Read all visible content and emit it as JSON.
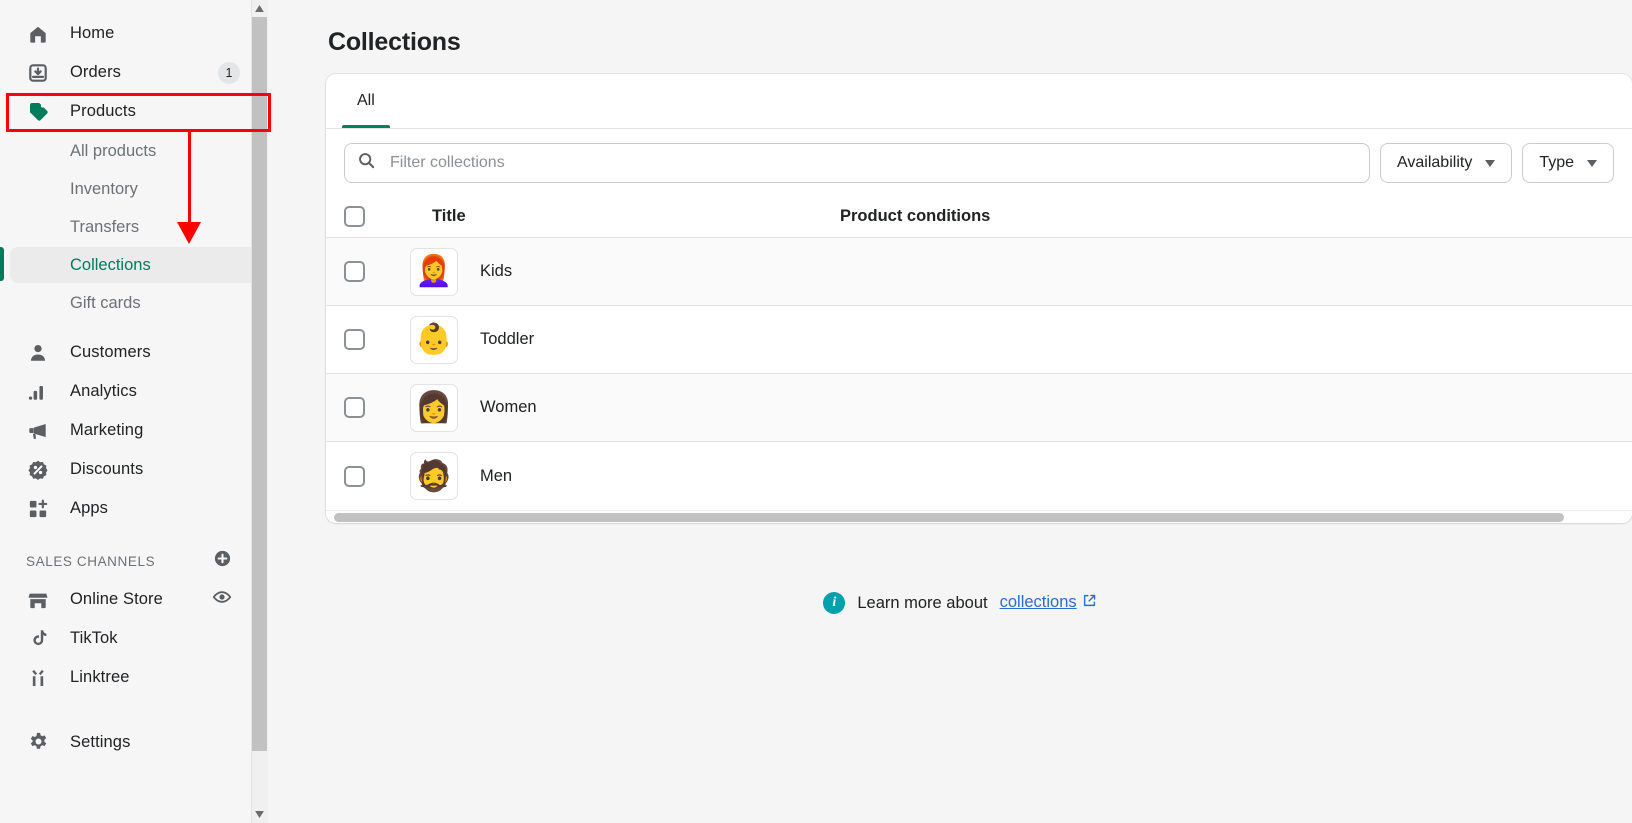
{
  "sidebar": {
    "nav": [
      {
        "label": "Home",
        "icon": "home-icon"
      },
      {
        "label": "Orders",
        "icon": "orders-inbox-icon",
        "badge": "1"
      },
      {
        "label": "Products",
        "icon": "products-tag-icon",
        "highlighted": true
      }
    ],
    "product_subnav": [
      {
        "label": "All products"
      },
      {
        "label": "Inventory"
      },
      {
        "label": "Transfers"
      },
      {
        "label": "Collections",
        "active": true
      },
      {
        "label": "Gift cards"
      }
    ],
    "nav2": [
      {
        "label": "Customers",
        "icon": "customer-person-icon"
      },
      {
        "label": "Analytics",
        "icon": "analytics-bars-icon"
      },
      {
        "label": "Marketing",
        "icon": "marketing-megaphone-icon"
      },
      {
        "label": "Discounts",
        "icon": "discounts-percent-icon"
      },
      {
        "label": "Apps",
        "icon": "apps-grid-plus-icon"
      }
    ],
    "sales_channels_header": "SALES CHANNELS",
    "sales_channels": [
      {
        "label": "Online Store",
        "icon": "store-icon",
        "trailing_icon": "eye-icon"
      },
      {
        "label": "TikTok",
        "icon": "tiktok-icon"
      },
      {
        "label": "Linktree",
        "icon": "linktree-icon"
      }
    ],
    "settings": {
      "label": "Settings",
      "icon": "gear-icon"
    }
  },
  "main": {
    "page_title": "Collections",
    "tabs": [
      {
        "label": "All",
        "active": true
      }
    ],
    "search": {
      "placeholder": "Filter collections",
      "value": "",
      "icon": "search-icon"
    },
    "filters": [
      {
        "label": "Availability",
        "icon": "chevron-down-icon"
      },
      {
        "label": "Type",
        "icon": "chevron-down-icon"
      }
    ],
    "table": {
      "columns": [
        "Title",
        "Product conditions"
      ],
      "rows": [
        {
          "title": "Kids",
          "thumb": "👩‍🦰",
          "product_conditions": ""
        },
        {
          "title": "Toddler",
          "thumb": "👶",
          "product_conditions": ""
        },
        {
          "title": "Women",
          "thumb": "👩",
          "product_conditions": ""
        },
        {
          "title": "Men",
          "thumb": "🧔",
          "product_conditions": ""
        }
      ]
    },
    "footer": {
      "info_icon": "info-icon",
      "text": "Learn more about",
      "link_label": "collections",
      "external_icon": "external-link-icon"
    }
  },
  "colors": {
    "accent_green": "#008060",
    "active_text": "#007b5c",
    "link_blue": "#2c6ecb",
    "info_teal": "#00a0ac",
    "annotation_red": "#ff0000"
  }
}
